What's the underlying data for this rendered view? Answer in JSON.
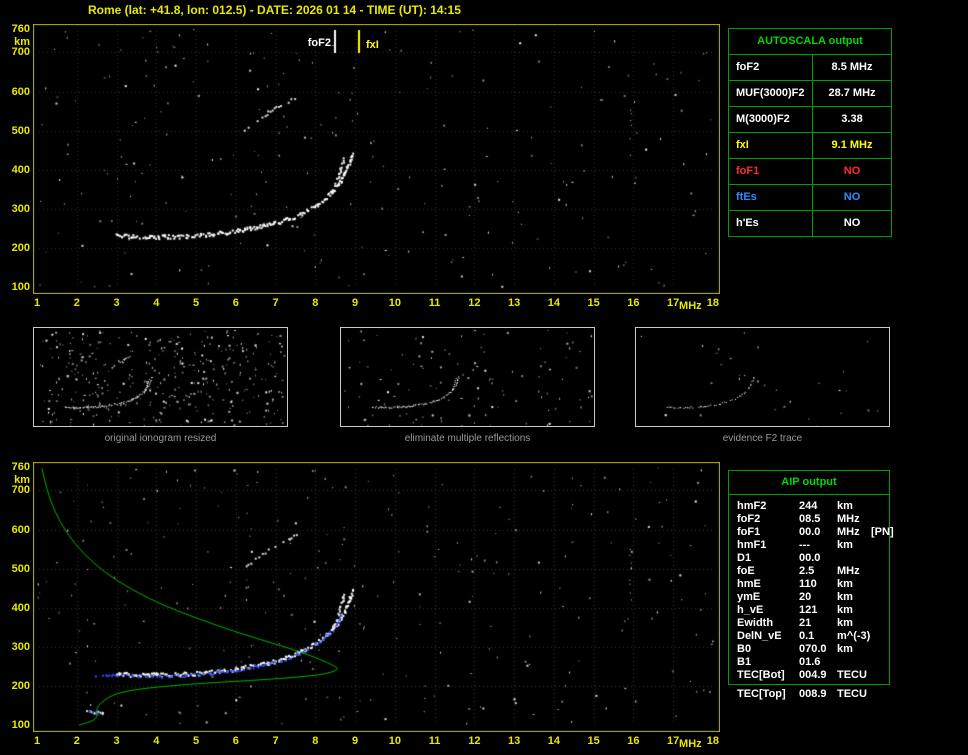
{
  "header": {
    "title": "Rome (lat: +41.8, lon: 012.5) - DATE: 2026 01 14 - TIME (UT): 14:15"
  },
  "colors": {
    "axis_yellow": "#e8e800",
    "plot_border": "#b8b800",
    "table_green": "#00d800",
    "table_border_green": "#00a000",
    "trace_white": "#ffffff",
    "restored_blue": "#2e4bff",
    "profile_green": "#00b400",
    "fof2_marker": "#ffffff",
    "fxi_marker": "#ffff00"
  },
  "axes": {
    "x_ticks": [
      "1",
      "2",
      "3",
      "4",
      "5",
      "6",
      "7",
      "8",
      "9",
      "10",
      "11",
      "12",
      "13",
      "14",
      "15",
      "16",
      "17",
      "18"
    ],
    "x_unit": "MHz",
    "y_ticks": [
      "760",
      "700",
      "600",
      "500",
      "400",
      "300",
      "200",
      "100"
    ],
    "y_unit": "km",
    "f_min": 1,
    "f_max": 18,
    "h_min": 100,
    "h_max": 760
  },
  "markers": {
    "fof2_label": "foF2",
    "fof2_freq": 8.5,
    "fxi_label": "fxI",
    "fxi_freq": 9.1
  },
  "autoscala": {
    "title": "AUTOSCALA output",
    "rows": [
      {
        "label": "foF2",
        "value": "8.5 MHz",
        "color": "white"
      },
      {
        "label": "MUF(3000)F2",
        "value": "28.7 MHz",
        "color": "white"
      },
      {
        "label": "M(3000)F2",
        "value": "3.38",
        "color": "white"
      },
      {
        "label": "fxI",
        "value": "9.1 MHz",
        "color": "yellow"
      },
      {
        "label": "foF1",
        "value": "NO",
        "color": "red"
      },
      {
        "label": "ftEs",
        "value": "NO",
        "color": "blue"
      },
      {
        "label": "h'Es",
        "value": "NO",
        "color": "white"
      }
    ]
  },
  "thumbnails": [
    {
      "caption": "original ionogram resized"
    },
    {
      "caption": "eliminate multiple reflections"
    },
    {
      "caption": "evidence F2 trace"
    }
  ],
  "aip": {
    "title": "AIP output",
    "rows": [
      {
        "label": "hmF2",
        "value": "244",
        "unit": "km",
        "note": ""
      },
      {
        "label": "foF2",
        "value": "08.5",
        "unit": "MHz",
        "note": ""
      },
      {
        "label": "foF1",
        "value": "00.0",
        "unit": "MHz",
        "note": "[PN]"
      },
      {
        "label": "hmF1",
        "value": "---",
        "unit": "km",
        "note": ""
      },
      {
        "label": "D1",
        "value": "00.0",
        "unit": "",
        "note": ""
      },
      {
        "label": "foE",
        "value": "2.5",
        "unit": "MHz",
        "note": ""
      },
      {
        "label": "hmE",
        "value": "110",
        "unit": "km",
        "note": ""
      },
      {
        "label": "ymE",
        "value": "20",
        "unit": "km",
        "note": ""
      },
      {
        "label": "h_vE",
        "value": "121",
        "unit": "km",
        "note": ""
      },
      {
        "label": "Ewidth",
        "value": "21",
        "unit": "km",
        "note": ""
      },
      {
        "label": "DelN_vE",
        "value": "0.1",
        "unit": "m^(-3)",
        "note": ""
      },
      {
        "label": "B0",
        "value": "070.0",
        "unit": "km",
        "note": ""
      },
      {
        "label": "B1",
        "value": "01.6",
        "unit": "",
        "note": ""
      },
      {
        "label": "TEC[Bot]",
        "value": "004.9",
        "unit": "TECU",
        "note": ""
      }
    ],
    "tec_top": {
      "label": "TEC[Top]",
      "value": "008.9",
      "unit": "TECU"
    }
  },
  "chart_data": {
    "type": "scatter",
    "title": "ionogram virtual height vs frequency",
    "xlabel": "MHz",
    "ylabel": "km",
    "xlim": [
      1,
      18
    ],
    "ylim": [
      100,
      760
    ]
  },
  "traces": {
    "f2": [
      [
        2.95,
        234
      ],
      [
        3.3,
        231
      ],
      [
        3.7,
        230
      ],
      [
        4.1,
        230
      ],
      [
        4.5,
        231
      ],
      [
        4.9,
        233
      ],
      [
        5.3,
        236
      ],
      [
        5.7,
        241
      ],
      [
        6.1,
        247
      ],
      [
        6.5,
        254
      ],
      [
        6.9,
        263
      ],
      [
        7.25,
        274
      ],
      [
        7.6,
        288
      ],
      [
        7.9,
        305
      ],
      [
        8.2,
        325
      ],
      [
        8.45,
        350
      ],
      [
        8.65,
        378
      ],
      [
        8.78,
        405
      ],
      [
        8.87,
        428
      ],
      [
        8.92,
        448
      ]
    ],
    "f2o": [
      [
        8.35,
        335
      ],
      [
        8.48,
        362
      ],
      [
        8.58,
        390
      ],
      [
        8.66,
        416
      ],
      [
        8.71,
        438
      ]
    ],
    "multiple": [
      [
        6.2,
        502
      ],
      [
        6.45,
        522
      ],
      [
        6.7,
        542
      ],
      [
        6.95,
        558
      ],
      [
        7.2,
        572
      ],
      [
        7.4,
        582
      ],
      [
        7.55,
        590
      ]
    ],
    "es": [
      [
        2.2,
        140
      ],
      [
        2.45,
        134
      ],
      [
        2.7,
        129
      ]
    ],
    "es_blue": [
      [
        2.3,
        136
      ],
      [
        2.55,
        131
      ]
    ],
    "blue": [
      [
        2.35,
        229
      ],
      [
        2.65,
        230
      ],
      [
        2.95,
        231
      ],
      [
        3.3,
        228
      ],
      [
        3.7,
        227
      ],
      [
        4.1,
        227
      ],
      [
        4.5,
        228
      ],
      [
        4.9,
        230
      ],
      [
        5.3,
        233
      ],
      [
        5.7,
        238
      ],
      [
        6.1,
        244
      ],
      [
        6.5,
        251
      ],
      [
        6.9,
        260
      ],
      [
        7.25,
        271
      ],
      [
        7.6,
        285
      ],
      [
        7.9,
        302
      ],
      [
        8.2,
        322
      ],
      [
        8.45,
        347
      ],
      [
        8.6,
        372
      ],
      [
        8.68,
        392
      ]
    ],
    "rfi": [
      [
        15.92,
        420
      ],
      [
        15.92,
        560
      ]
    ],
    "profile": [
      [
        1.12,
        758
      ],
      [
        1.25,
        700
      ],
      [
        1.45,
        645
      ],
      [
        1.75,
        590
      ],
      [
        2.15,
        540
      ],
      [
        2.7,
        490
      ],
      [
        3.4,
        445
      ],
      [
        4.2,
        405
      ],
      [
        5.1,
        370
      ],
      [
        6.0,
        338
      ],
      [
        6.9,
        310
      ],
      [
        7.7,
        285
      ],
      [
        8.25,
        262
      ],
      [
        8.5,
        250
      ],
      [
        8.58,
        244
      ],
      [
        8.45,
        236
      ],
      [
        8.1,
        228
      ],
      [
        7.4,
        221
      ],
      [
        6.4,
        214
      ],
      [
        5.2,
        207
      ],
      [
        4.2,
        199
      ],
      [
        3.5,
        191
      ],
      [
        3.05,
        182
      ],
      [
        2.8,
        171
      ],
      [
        2.62,
        158
      ],
      [
        2.52,
        145
      ],
      [
        2.47,
        131
      ],
      [
        2.52,
        121
      ],
      [
        2.42,
        112
      ],
      [
        2.25,
        105
      ],
      [
        2.05,
        100
      ]
    ]
  }
}
